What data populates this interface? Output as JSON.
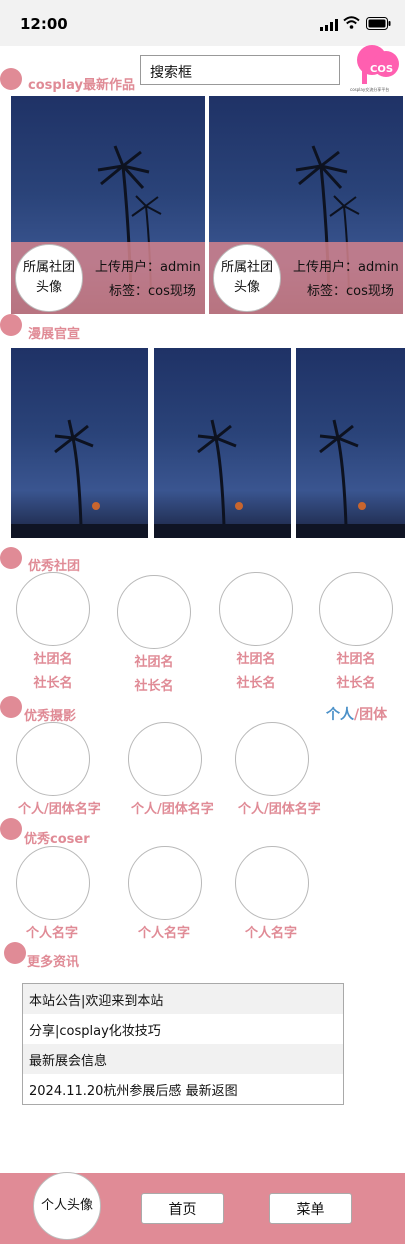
{
  "status_bar": {
    "time": "12:00"
  },
  "search": {
    "label": "搜索框"
  },
  "logo": {
    "text": "COS",
    "small": "cosplay交流分享平台"
  },
  "sections": {
    "latest": "cosplay最新作品",
    "expo": "漫展官宣",
    "clubs": "优秀社团",
    "photo": "优秀摄影",
    "coser": "优秀coser",
    "news": "更多资讯"
  },
  "works": [
    {
      "avatar": "所属社团头像",
      "uploader": "上传用户：admin",
      "tag": "标签：cos现场"
    },
    {
      "avatar": "所属社团头像",
      "uploader": "上传用户：admin",
      "tag": "标签：cos现场"
    }
  ],
  "clubs": [
    {
      "name": "社团名",
      "leader": "社长名"
    },
    {
      "name": "社团名",
      "leader": "社长名"
    },
    {
      "name": "社团名",
      "leader": "社长名"
    },
    {
      "name": "社团名",
      "leader": "社长名"
    }
  ],
  "photo_filter": {
    "personal": "个人",
    "sep": "/",
    "team": "团体"
  },
  "photographers": [
    "个人/团体名字",
    "个人/团体名字",
    "个人/团体名字"
  ],
  "cosers": [
    "个人名字",
    "个人名字",
    "个人名字"
  ],
  "news": [
    "本站公告|欢迎来到本站",
    "分享|cosplay化妆技巧",
    "最新展会信息",
    "2024.11.20杭州参展后感 最新返图"
  ],
  "bottom_nav": {
    "avatar": "个人头像",
    "home": "首页",
    "menu": "菜单"
  },
  "colors": {
    "accent": "#e08b96",
    "link": "#4a90c8",
    "logo": "#ff5fb0"
  }
}
